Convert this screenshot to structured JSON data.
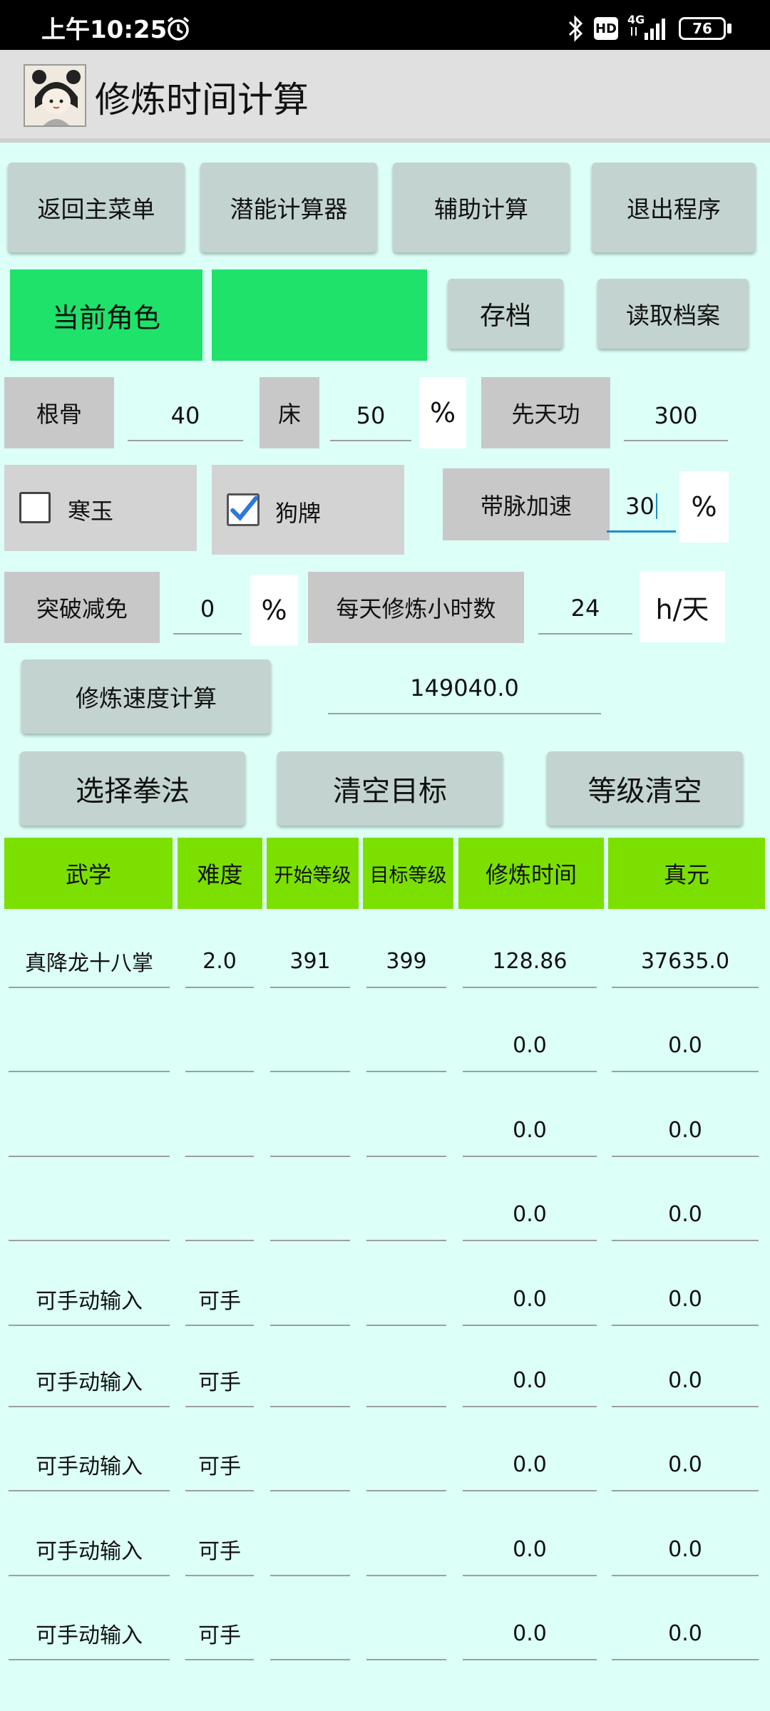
{
  "status": {
    "time": "上午10:25",
    "battery": "76",
    "hd": "HD",
    "net": "4G"
  },
  "app": {
    "title": "修炼时间计算"
  },
  "nav": {
    "back": "返回主菜单",
    "potential": "潜能计算器",
    "assist": "辅助计算",
    "exit": "退出程序"
  },
  "role": {
    "label": "当前角色",
    "name": "",
    "save": "存档",
    "load": "读取档案"
  },
  "stats": {
    "genGu_label": "根骨",
    "genGu_value": "40",
    "bed_label": "床",
    "bed_value": "50",
    "bed_unit": "%",
    "xiantian_label": "先天功",
    "xiantian_value": "300"
  },
  "items": {
    "hanyu_label": "寒玉",
    "hanyu_checked": false,
    "goupai_label": "狗牌",
    "goupai_checked": true,
    "daimai_label": "带脉加速",
    "daimai_value": "30",
    "daimai_unit": "%"
  },
  "break": {
    "label": "突破减免",
    "value": "0",
    "unit": "%",
    "hours_label": "每天修炼小时数",
    "hours_value": "24",
    "hours_unit": "h/天"
  },
  "speed": {
    "button": "修炼速度计算",
    "value": "149040.0"
  },
  "actions": {
    "select": "选择拳法",
    "clear_target": "清空目标",
    "clear_level": "等级清空"
  },
  "table": {
    "headers": [
      "武学",
      "难度",
      "开始等级",
      "目标等级",
      "修炼时间",
      "真元"
    ],
    "rows": [
      {
        "skill": "真降龙十八掌",
        "difficulty": "2.0",
        "start": "391",
        "target": "399",
        "time": "128.86",
        "zhenyuan": "37635.0"
      },
      {
        "skill": "",
        "difficulty": "",
        "start": "",
        "target": "",
        "time": "0.0",
        "zhenyuan": "0.0"
      },
      {
        "skill": "",
        "difficulty": "",
        "start": "",
        "target": "",
        "time": "0.0",
        "zhenyuan": "0.0"
      },
      {
        "skill": "",
        "difficulty": "",
        "start": "",
        "target": "",
        "time": "0.0",
        "zhenyuan": "0.0"
      },
      {
        "skill": "可手动输入",
        "difficulty": "可手",
        "start": "",
        "target": "",
        "time": "0.0",
        "zhenyuan": "0.0"
      },
      {
        "skill": "可手动输入",
        "difficulty": "可手",
        "start": "",
        "target": "",
        "time": "0.0",
        "zhenyuan": "0.0"
      },
      {
        "skill": "可手动输入",
        "difficulty": "可手",
        "start": "",
        "target": "",
        "time": "0.0",
        "zhenyuan": "0.0"
      },
      {
        "skill": "可手动输入",
        "difficulty": "可手",
        "start": "",
        "target": "",
        "time": "0.0",
        "zhenyuan": "0.0"
      },
      {
        "skill": "可手动输入",
        "difficulty": "可手",
        "start": "",
        "target": "",
        "time": "0.0",
        "zhenyuan": "0.0"
      }
    ]
  },
  "colors": {
    "background": "#dcfff7",
    "header_green": "#7be000",
    "role_green": "#1ee26a",
    "button": "#c3d4d0"
  }
}
